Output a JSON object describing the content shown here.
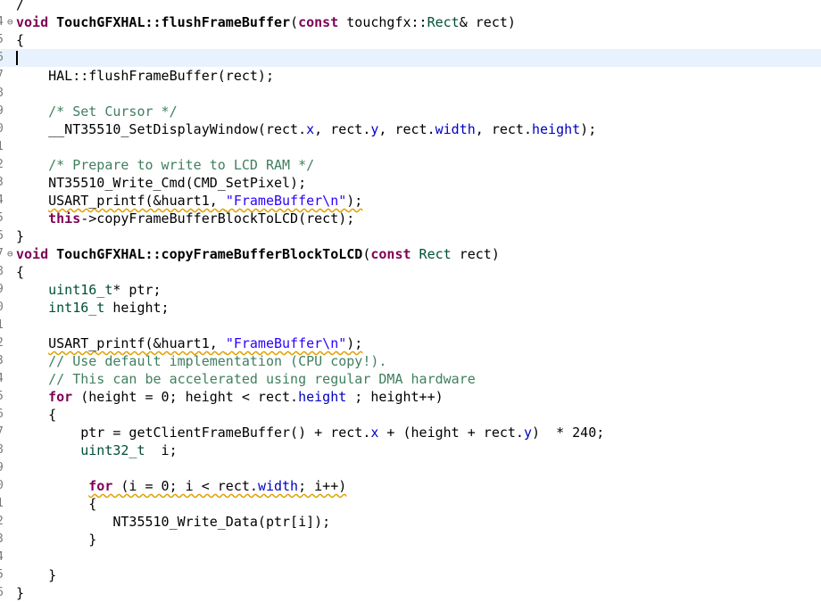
{
  "editor": {
    "lines": [
      {
        "n": "",
        "fold": "",
        "cur": false,
        "tokens": [
          {
            "t": "/",
            "c": "plain"
          }
        ]
      },
      {
        "n": "4",
        "fold": "⊖",
        "cur": false,
        "tokens": [
          {
            "t": "void",
            "c": "kw"
          },
          {
            "t": " ",
            "c": "plain"
          },
          {
            "t": "TouchGFXHAL::flushFrameBuffer",
            "c": "bold"
          },
          {
            "t": "(",
            "c": "plain"
          },
          {
            "t": "const",
            "c": "kw"
          },
          {
            "t": " touchgfx::",
            "c": "plain"
          },
          {
            "t": "Rect",
            "c": "typ"
          },
          {
            "t": "& rect)",
            "c": "plain"
          }
        ]
      },
      {
        "n": "5",
        "fold": "",
        "cur": false,
        "tokens": [
          {
            "t": "{",
            "c": "plain"
          }
        ]
      },
      {
        "n": "6",
        "fold": "",
        "cur": true,
        "tokens": []
      },
      {
        "n": "7",
        "fold": "",
        "cur": false,
        "tokens": [
          {
            "t": "    HAL::flushFrameBuffer(rect);",
            "c": "plain"
          }
        ]
      },
      {
        "n": "8",
        "fold": "",
        "cur": false,
        "tokens": []
      },
      {
        "n": "9",
        "fold": "",
        "cur": false,
        "tokens": [
          {
            "t": "    ",
            "c": "plain"
          },
          {
            "t": "/* Set Cursor */",
            "c": "cm"
          }
        ]
      },
      {
        "n": "0",
        "fold": "",
        "cur": false,
        "tokens": [
          {
            "t": "    __NT35510_SetDisplayWindow(rect.",
            "c": "plain"
          },
          {
            "t": "x",
            "c": "fld"
          },
          {
            "t": ", rect.",
            "c": "plain"
          },
          {
            "t": "y",
            "c": "fld"
          },
          {
            "t": ", rect.",
            "c": "plain"
          },
          {
            "t": "width",
            "c": "fld"
          },
          {
            "t": ", rect.",
            "c": "plain"
          },
          {
            "t": "height",
            "c": "fld"
          },
          {
            "t": ");",
            "c": "plain"
          }
        ]
      },
      {
        "n": "1",
        "fold": "",
        "cur": false,
        "tokens": []
      },
      {
        "n": "2",
        "fold": "",
        "cur": false,
        "tokens": [
          {
            "t": "    ",
            "c": "plain"
          },
          {
            "t": "/* Prepare to write to LCD RAM */",
            "c": "cm"
          }
        ]
      },
      {
        "n": "3",
        "fold": "",
        "cur": false,
        "tokens": [
          {
            "t": "    NT35510_Write_Cmd(CMD_SetPixel);",
            "c": "plain"
          }
        ]
      },
      {
        "n": "4",
        "fold": "",
        "cur": false,
        "tokens": [
          {
            "t": "    ",
            "c": "plain"
          },
          {
            "t": "USART_printf(&huart1, ",
            "c": "plain squig"
          },
          {
            "t": "\"FrameBuffer\\n\"",
            "c": "str squig"
          },
          {
            "t": ");",
            "c": "plain squig"
          }
        ]
      },
      {
        "n": "5",
        "fold": "",
        "cur": false,
        "tokens": [
          {
            "t": "    ",
            "c": "plain"
          },
          {
            "t": "this",
            "c": "kw"
          },
          {
            "t": "->copyFrameBufferBlockToLCD(rect);",
            "c": "plain"
          }
        ]
      },
      {
        "n": "6",
        "fold": "",
        "cur": false,
        "tokens": [
          {
            "t": "}",
            "c": "plain"
          }
        ]
      },
      {
        "n": "7",
        "fold": "⊖",
        "cur": false,
        "tokens": [
          {
            "t": "void",
            "c": "kw"
          },
          {
            "t": " ",
            "c": "plain"
          },
          {
            "t": "TouchGFXHAL::copyFrameBufferBlockToLCD",
            "c": "bold"
          },
          {
            "t": "(",
            "c": "plain"
          },
          {
            "t": "const",
            "c": "kw"
          },
          {
            "t": " ",
            "c": "plain"
          },
          {
            "t": "Rect",
            "c": "typ"
          },
          {
            "t": " rect)",
            "c": "plain"
          }
        ]
      },
      {
        "n": "8",
        "fold": "",
        "cur": false,
        "tokens": [
          {
            "t": "{",
            "c": "plain"
          }
        ]
      },
      {
        "n": "9",
        "fold": "",
        "cur": false,
        "tokens": [
          {
            "t": "    ",
            "c": "plain"
          },
          {
            "t": "uint16_t",
            "c": "typ"
          },
          {
            "t": "* ptr;",
            "c": "plain"
          }
        ]
      },
      {
        "n": "0",
        "fold": "",
        "cur": false,
        "tokens": [
          {
            "t": "    ",
            "c": "plain"
          },
          {
            "t": "int16_t",
            "c": "typ"
          },
          {
            "t": " height;",
            "c": "plain"
          }
        ]
      },
      {
        "n": "1",
        "fold": "",
        "cur": false,
        "tokens": []
      },
      {
        "n": "2",
        "fold": "",
        "cur": false,
        "tokens": [
          {
            "t": "    ",
            "c": "plain"
          },
          {
            "t": "USART_printf(&huart1, ",
            "c": "plain squig"
          },
          {
            "t": "\"FrameBuffer\\n\"",
            "c": "str squig"
          },
          {
            "t": ");",
            "c": "plain squig"
          }
        ]
      },
      {
        "n": "3",
        "fold": "",
        "cur": false,
        "tokens": [
          {
            "t": "    ",
            "c": "plain"
          },
          {
            "t": "// Use default implementation (CPU copy!).",
            "c": "cm"
          }
        ]
      },
      {
        "n": "4",
        "fold": "",
        "cur": false,
        "tokens": [
          {
            "t": "    ",
            "c": "plain"
          },
          {
            "t": "// This can be accelerated using regular DMA hardware",
            "c": "cm"
          }
        ]
      },
      {
        "n": "5",
        "fold": "",
        "cur": false,
        "tokens": [
          {
            "t": "    ",
            "c": "plain"
          },
          {
            "t": "for",
            "c": "kw"
          },
          {
            "t": " (height = 0; height < rect.",
            "c": "plain"
          },
          {
            "t": "height",
            "c": "fld"
          },
          {
            "t": " ; height++)",
            "c": "plain"
          }
        ]
      },
      {
        "n": "6",
        "fold": "",
        "cur": false,
        "tokens": [
          {
            "t": "    {",
            "c": "plain"
          }
        ]
      },
      {
        "n": "7",
        "fold": "",
        "cur": false,
        "tokens": [
          {
            "t": "        ptr = getClientFrameBuffer() + rect.",
            "c": "plain"
          },
          {
            "t": "x",
            "c": "fld"
          },
          {
            "t": " + (height + rect.",
            "c": "plain"
          },
          {
            "t": "y",
            "c": "fld"
          },
          {
            "t": ")  * 240;",
            "c": "plain"
          }
        ]
      },
      {
        "n": "8",
        "fold": "",
        "cur": false,
        "tokens": [
          {
            "t": "        ",
            "c": "plain"
          },
          {
            "t": "uint32_t",
            "c": "typ"
          },
          {
            "t": "  i;",
            "c": "plain"
          }
        ]
      },
      {
        "n": "9",
        "fold": "",
        "cur": false,
        "tokens": []
      },
      {
        "n": "0",
        "fold": "",
        "cur": false,
        "tokens": [
          {
            "t": "         ",
            "c": "plain"
          },
          {
            "t": "for",
            "c": "kw squig"
          },
          {
            "t": " (i = 0; i < rect.",
            "c": "plain squig"
          },
          {
            "t": "width",
            "c": "fld squig"
          },
          {
            "t": "; i++)",
            "c": "plain squig"
          }
        ]
      },
      {
        "n": "1",
        "fold": "",
        "cur": false,
        "tokens": [
          {
            "t": "         {",
            "c": "plain"
          }
        ]
      },
      {
        "n": "2",
        "fold": "",
        "cur": false,
        "tokens": [
          {
            "t": "            NT35510_Write_Data(ptr[i]);",
            "c": "plain"
          }
        ]
      },
      {
        "n": "3",
        "fold": "",
        "cur": false,
        "tokens": [
          {
            "t": "         }",
            "c": "plain"
          }
        ]
      },
      {
        "n": "4",
        "fold": "",
        "cur": false,
        "tokens": []
      },
      {
        "n": "5",
        "fold": "",
        "cur": false,
        "tokens": [
          {
            "t": "    }",
            "c": "plain"
          }
        ]
      },
      {
        "n": "6",
        "fold": "",
        "cur": false,
        "tokens": [
          {
            "t": "}",
            "c": "plain"
          }
        ]
      }
    ]
  }
}
